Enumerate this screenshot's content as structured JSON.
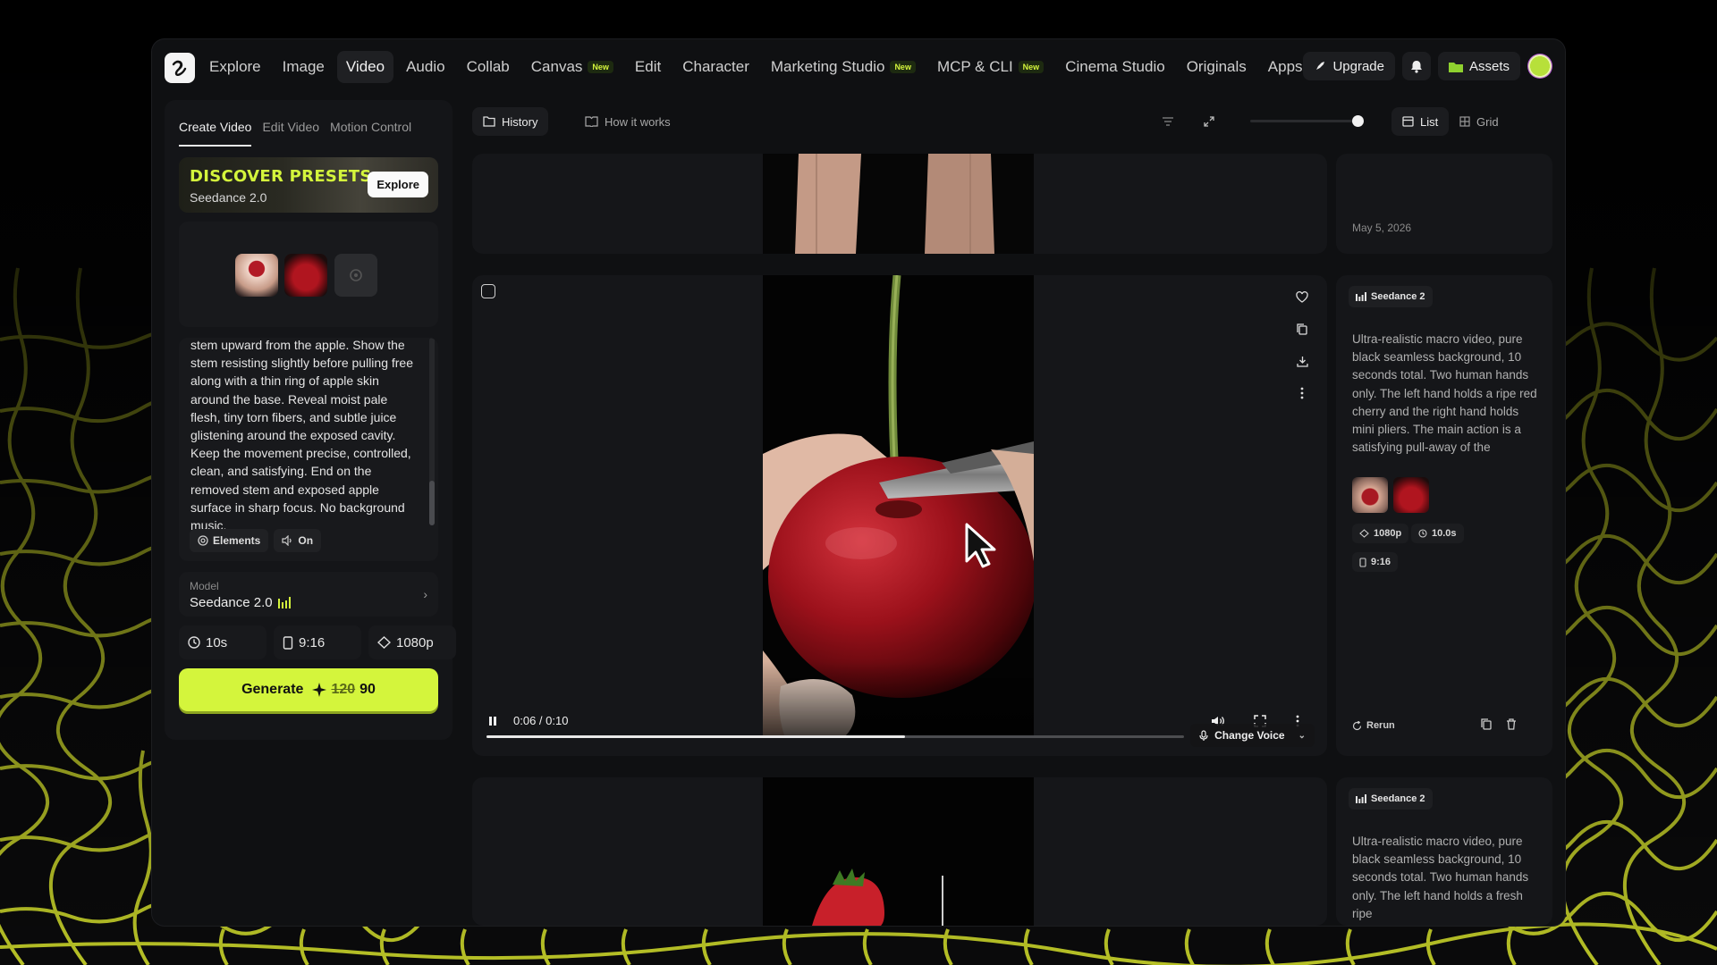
{
  "nav": {
    "items": [
      {
        "label": "Explore",
        "badge": "",
        "active": false
      },
      {
        "label": "Image",
        "badge": "",
        "active": false
      },
      {
        "label": "Video",
        "badge": "",
        "active": true
      },
      {
        "label": "Audio",
        "badge": "",
        "active": false
      },
      {
        "label": "Collab",
        "badge": "",
        "active": false
      },
      {
        "label": "Canvas",
        "badge": "New",
        "active": false
      },
      {
        "label": "Edit",
        "badge": "",
        "active": false
      },
      {
        "label": "Character",
        "badge": "",
        "active": false
      },
      {
        "label": "Marketing Studio",
        "badge": "New",
        "active": false
      },
      {
        "label": "MCP & CLI",
        "badge": "New",
        "active": false
      },
      {
        "label": "Cinema Studio",
        "badge": "",
        "active": false
      },
      {
        "label": "Originals",
        "badge": "",
        "active": false
      },
      {
        "label": "Apps",
        "badge": "",
        "active": false
      }
    ],
    "upgrade": "Upgrade",
    "assets": "Assets"
  },
  "left": {
    "tabs": [
      "Create Video",
      "Edit Video",
      "Motion Control"
    ],
    "presets_title": "DISCOVER PRESETS",
    "presets_sub": "Seedance 2.0",
    "explore": "Explore",
    "prompt": "stem upward from the apple. Show the stem resisting slightly before pulling free along with a thin ring of apple skin around the base. Reveal moist pale flesh, tiny torn fibers, and subtle juice glistening around the exposed cavity. Keep the movement precise, controlled, clean, and satisfying. End on the removed stem and exposed apple surface in sharp focus. No background music.",
    "elements": "Elements",
    "audio": "On",
    "model_label": "Model",
    "model": "Seedance 2.0",
    "duration": "10s",
    "ratio": "9:16",
    "resolution": "1080p",
    "generate": "Generate",
    "cost_old": "120",
    "cost_new": "90"
  },
  "main": {
    "history": "History",
    "how": "How it works",
    "list": "List",
    "grid": "Grid",
    "zoom_level": 0.95
  },
  "cards": [
    {
      "date": "May 5, 2026"
    },
    {
      "model": "Seedance 2",
      "desc": "Ultra-realistic macro video, pure black seamless background, 10 seconds total. Two human hands only. The left hand holds a ripe red cherry and the right hand holds mini pliers. The main action is a satisfying pull-away of the",
      "resolution": "1080p",
      "duration": "10.0s",
      "ratio": "9:16",
      "time": "0:06 / 0:10",
      "progress": 0.6,
      "change_voice": "Change Voice",
      "rerun": "Rerun"
    },
    {
      "model": "Seedance 2",
      "desc": "Ultra-realistic macro video, pure black seamless background, 10 seconds total. Two human hands only. The left hand holds a fresh ripe"
    }
  ],
  "colors": {
    "accent": "#d4f53c",
    "background": "#0f1012",
    "panel": "#151619"
  }
}
